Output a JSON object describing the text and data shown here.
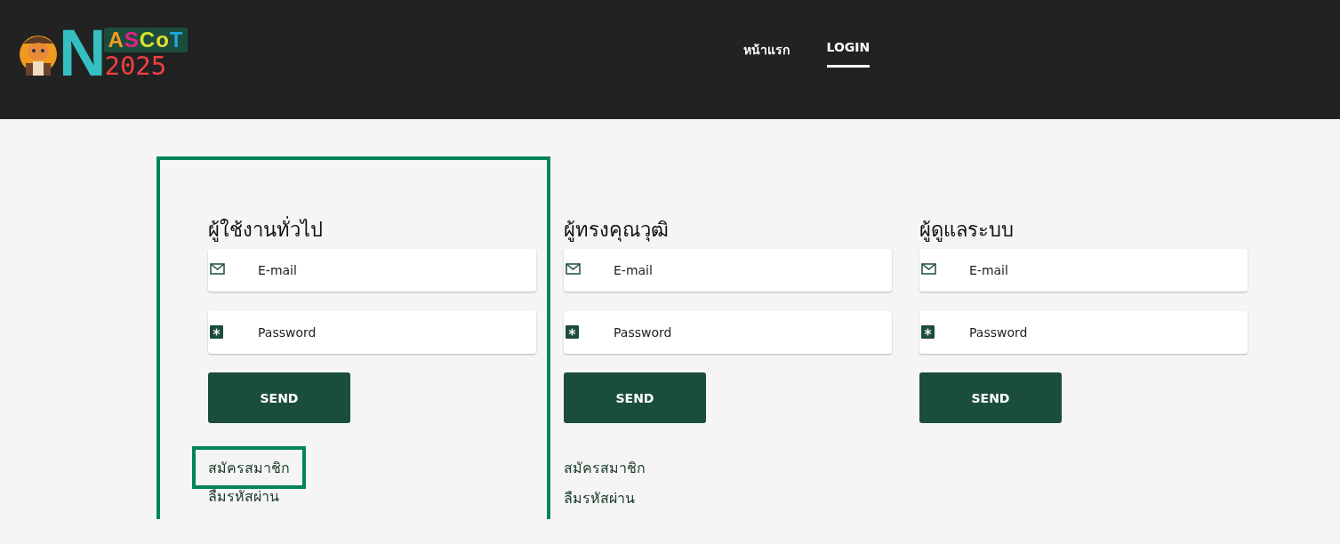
{
  "logo": {
    "initial": "N",
    "word": "ASCoT",
    "year": "2025"
  },
  "nav": [
    {
      "label": "หน้าแรก",
      "selected": false
    },
    {
      "label": "LOGIN",
      "selected": true
    }
  ],
  "panels": [
    {
      "title": "ผู้ใช้งานทั่วไป",
      "highlighted": true,
      "email_placeholder": "E-mail",
      "password_placeholder": "Password",
      "button": "SEND",
      "links": [
        {
          "label": "สมัครสมาชิก",
          "highlighted": true
        },
        {
          "label": "ลืมรหัสผ่าน",
          "highlighted": false
        }
      ]
    },
    {
      "title": "ผู้ทรงคุณวุฒิ",
      "highlighted": false,
      "email_placeholder": "E-mail",
      "password_placeholder": "Password",
      "button": "SEND",
      "links": [
        {
          "label": "สมัครสมาชิก",
          "highlighted": false
        },
        {
          "label": "ลืมรหัสผ่าน",
          "highlighted": false
        }
      ]
    },
    {
      "title": "ผู้ดูแลระบบ",
      "highlighted": false,
      "email_placeholder": "E-mail",
      "password_placeholder": "Password",
      "button": "SEND"
    }
  ]
}
